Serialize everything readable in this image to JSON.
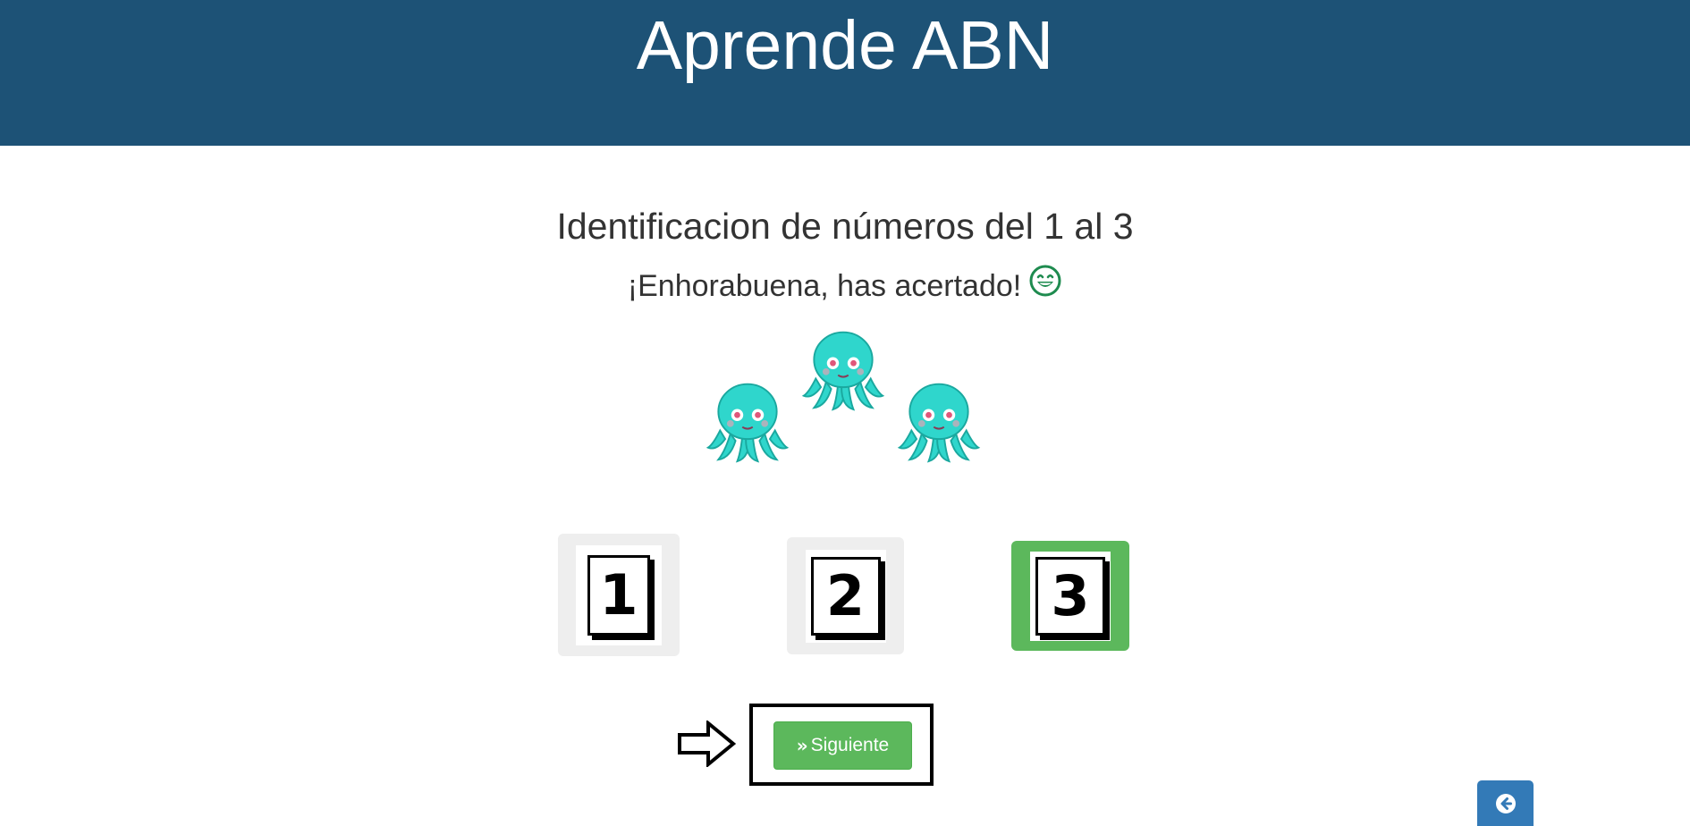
{
  "header": {
    "title": "Aprende ABN"
  },
  "exercise": {
    "title": "Identificacion de números del 1 al 3",
    "feedback": "¡Enhorabuena, has acertado!",
    "feedback_icon": "grinning-face-icon",
    "items_shown": 3,
    "item_icon": "octopus-icon"
  },
  "choices": [
    {
      "label": "1",
      "selected": false
    },
    {
      "label": "2",
      "selected": false
    },
    {
      "label": "3",
      "selected": true
    }
  ],
  "next_button": {
    "label": "Siguiente",
    "icon": "double-chevron-right-icon"
  },
  "back_button": {
    "icon": "arrow-circle-left-icon"
  },
  "colors": {
    "header_bg": "#1d5276",
    "choice_bg": "#eeeeee",
    "choice_selected_bg": "#5cb85c",
    "button_green": "#5cb85c",
    "button_blue": "#337ab7"
  }
}
